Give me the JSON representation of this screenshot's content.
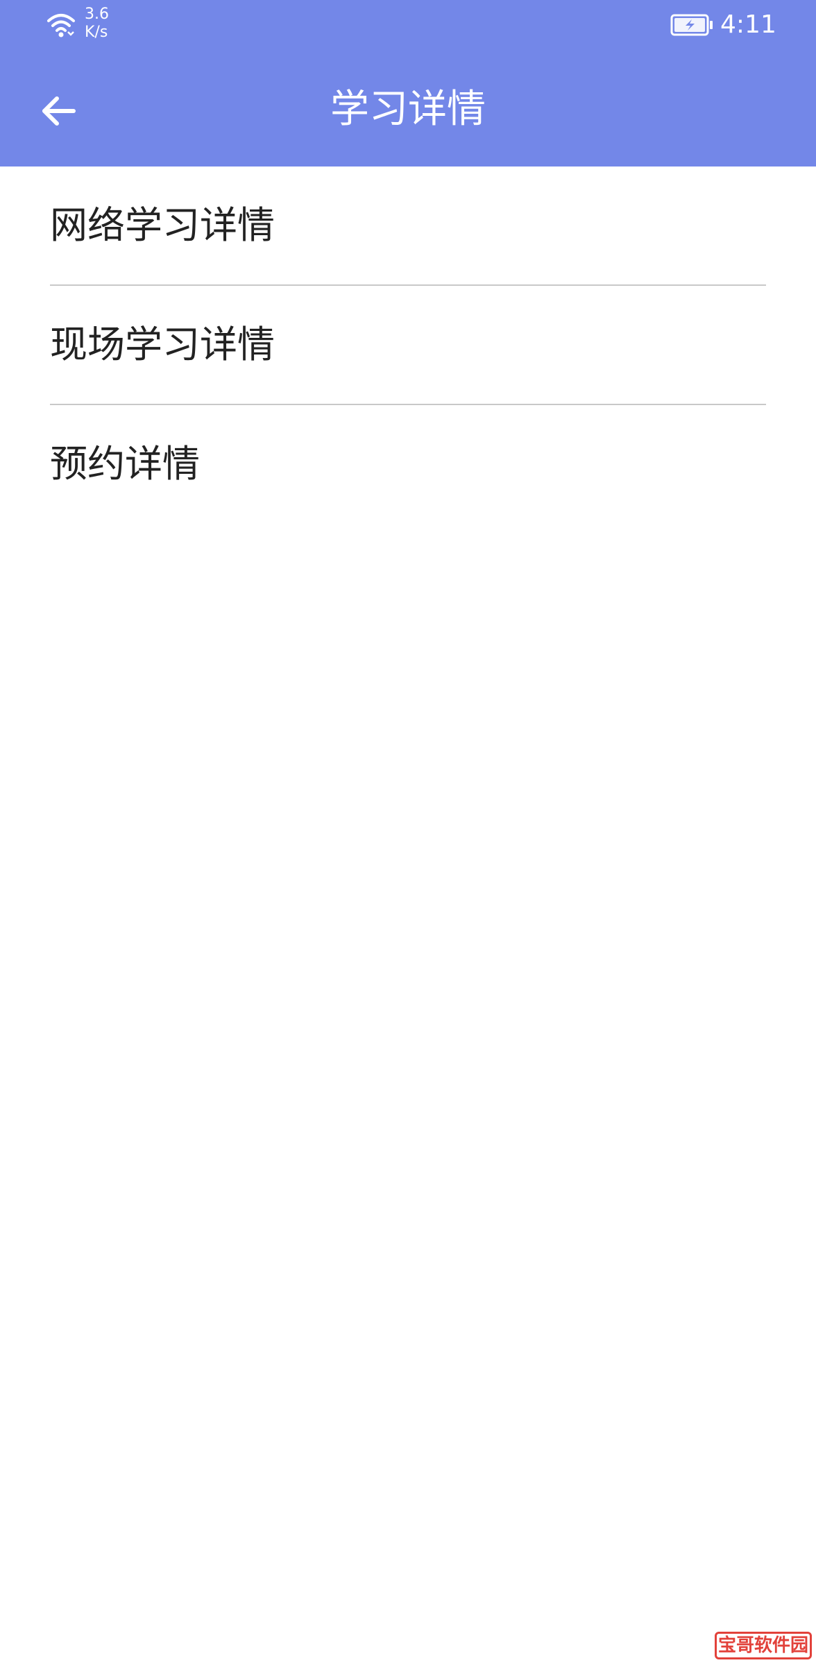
{
  "status_bar": {
    "net_speed_value": "3.6",
    "net_speed_unit": "K/s",
    "time": "4:11",
    "icons": [
      "wifi-icon",
      "battery-charging-icon"
    ]
  },
  "app_bar": {
    "title": "学习详情",
    "back_icon": "arrow-left-icon"
  },
  "menu": {
    "items": [
      {
        "label": "网络学习详情"
      },
      {
        "label": "现场学习详情"
      },
      {
        "label": "预约详情"
      }
    ]
  },
  "watermark": {
    "text": "宝哥软件园"
  },
  "colors": {
    "accent": "#7387E8",
    "text": "#222222",
    "divider": "#C8C8C8",
    "background": "#FFFFFF",
    "watermark": "#E2413A"
  }
}
